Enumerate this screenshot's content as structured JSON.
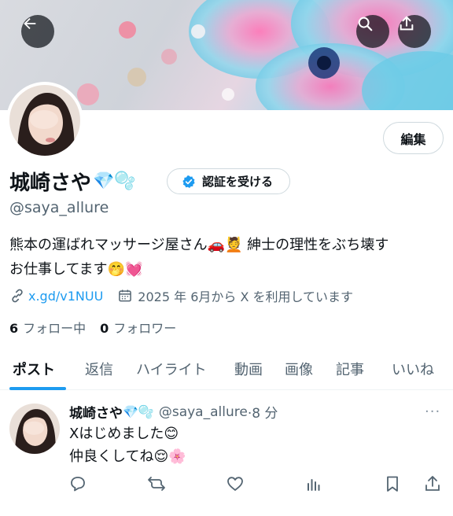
{
  "header": {
    "back_icon": "arrow-left-icon",
    "search_icon": "search-icon",
    "share_icon": "share-icon"
  },
  "profile": {
    "name": "城崎さや",
    "name_emojis": "💎🫧",
    "verify_label": "認証を受ける",
    "edit_label": "編集",
    "handle": "@saya_allure",
    "bio_line1": "熊本の運ばれマッサージ屋さん🚗💆 紳士の理性をぶち壊す",
    "bio_line2": "お仕事してます🤭💓",
    "link_text": "x.gd/v1NUU",
    "joined_text": "2025 年 6月から X を利用しています",
    "following_count": "6",
    "following_label": "フォロー中",
    "followers_count": "0",
    "followers_label": "フォロワー"
  },
  "tabs": [
    {
      "label": "ポスト"
    },
    {
      "label": "返信"
    },
    {
      "label": "ハイライト"
    },
    {
      "label": "動画"
    },
    {
      "label": "画像"
    },
    {
      "label": "記事"
    },
    {
      "label": "いいね"
    }
  ],
  "post": {
    "name": "城崎さや",
    "name_emojis": "💎🫧",
    "handle": "@saya_allure",
    "time": "·8 分",
    "more": "···",
    "line1": "Xはじめました😊",
    "line2": "仲良くしてね😌🌸"
  },
  "colors": {
    "accent": "#1d9bf0",
    "secondary_text": "#536471",
    "primary_text": "#0f1419"
  }
}
